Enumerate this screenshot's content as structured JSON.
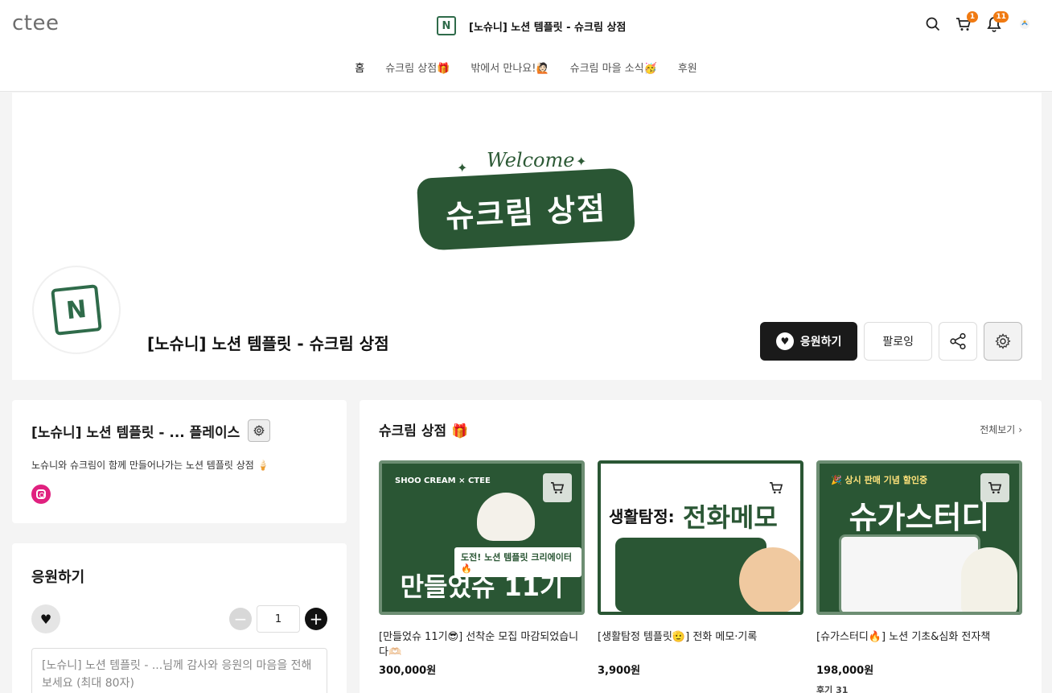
{
  "header": {
    "logo": "ctee",
    "shop_icon_letter": "N",
    "shop_title": "[노슈니] 노션 템플릿 - 슈크림 상점",
    "cart_badge": "1",
    "notif_badge": "11"
  },
  "nav": {
    "items": [
      "홈",
      "슈크림 상점🎁",
      "밖에서 만나요!🙋🏻",
      "슈크림 마을 소식🥳",
      "후원"
    ]
  },
  "hero": {
    "banner_welcome": "Welcome",
    "banner_text": "슈크림 상점",
    "avatar_letter": "N",
    "shop_name": "[노슈니] 노션 템플릿 - 슈크림 상점",
    "support_label": "응원하기",
    "follow_label": "팔로잉"
  },
  "profile": {
    "title": "[노슈니] 노션 템플릿 - ... 플레이스",
    "description": "노슈니와 슈크림이 함께 만들어나가는 노션 템플릿 상점 🍦"
  },
  "support": {
    "title": "응원하기",
    "quantity": "1",
    "message_placeholder": "[노슈니] 노션 템플릿 - ...님께 감사와 응원의 마음을 전해보세요 (최대 80자)"
  },
  "products_section": {
    "title": "슈크림 상점 🎁",
    "see_all": "전체보기",
    "items": [
      {
        "thumb_top": "SHOO CREAM × CTEE",
        "thumb_chip": "도전! 노션 템플릿 크리에이터🔥",
        "thumb_big": "만들었슈 11기",
        "name": "[만들었슈 11기😎] 선착순 모집 마감되었습니다🫶🏻",
        "price": "300,000원"
      },
      {
        "thumb_top": "생활탐정:",
        "thumb_big": "전화메모",
        "name": "[생활탐정 템플릿🫡] 전화 메모·기록",
        "price": "3,900원"
      },
      {
        "thumb_top": "🎉 상시 판매 기념 할인중",
        "thumb_big": "슈가스터디",
        "name": "[슈가스터디🔥] 노션 기초&심화 전자책",
        "price": "198,000원",
        "review": "후기 31"
      }
    ]
  },
  "colors": {
    "brand_green": "#2a5634",
    "badge_orange": "#f07a12",
    "instagram": "#e0217f"
  }
}
